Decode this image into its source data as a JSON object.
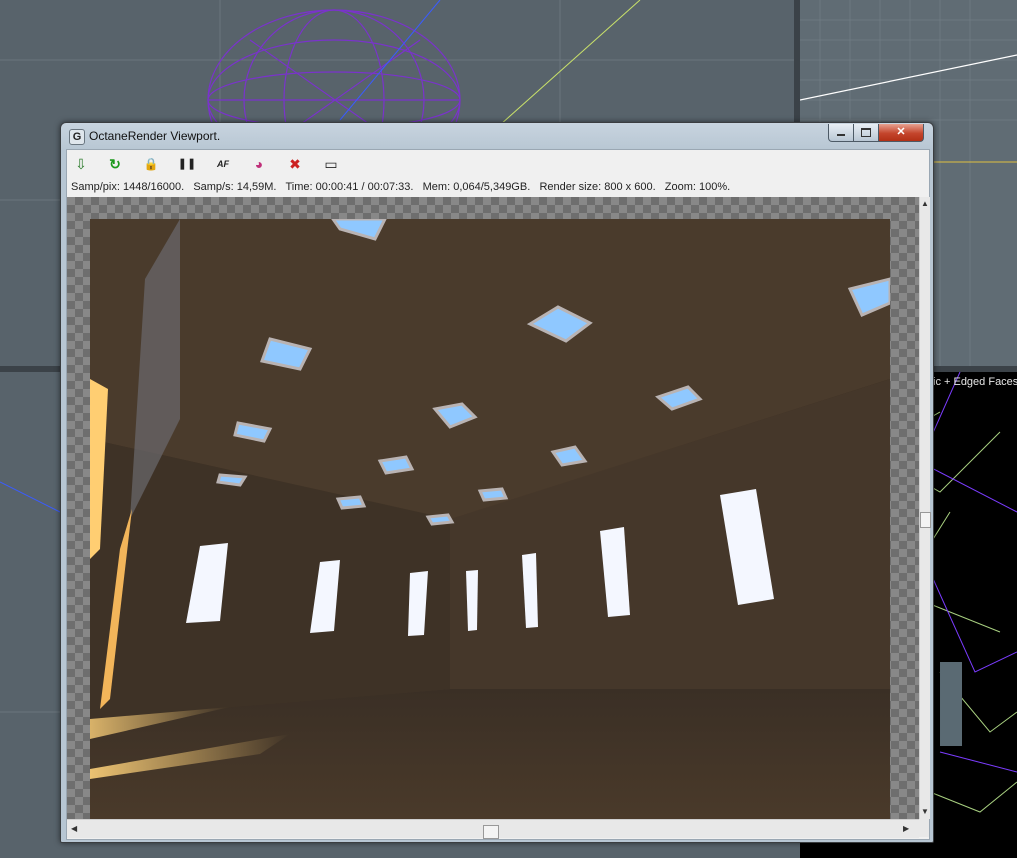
{
  "window": {
    "title": "OctaneRender Viewport.",
    "app_icon": "octane-logo-icon"
  },
  "toolbar": {
    "buttons": [
      {
        "name": "send-scene-icon",
        "glyph": "⇩"
      },
      {
        "name": "restart-render-icon",
        "glyph": "↻"
      },
      {
        "name": "lock-icon",
        "glyph": "🔒"
      },
      {
        "name": "pause-icon",
        "glyph": "❚❚"
      },
      {
        "name": "autofocus-icon",
        "glyph": "AF"
      },
      {
        "name": "color-picker-icon",
        "glyph": "◕"
      },
      {
        "name": "stop-render-icon",
        "glyph": "✖"
      },
      {
        "name": "display-settings-icon",
        "glyph": "▭"
      }
    ]
  },
  "status": {
    "samp_pix": "Samp/pix: 1448/16000.",
    "samp_s": "Samp/s: 14,59M.",
    "time": "Time: 00:00:41 / 00:07:33.",
    "mem": "Mem: 0,064/5,349GB.",
    "render_size": "Render size: 800 x 600.",
    "zoom": "Zoom: 100%."
  },
  "background": {
    "viewport_label": "ic + Edged Faces"
  },
  "colors": {
    "wireframe_sphere": "#7a33cc",
    "viewport_bg": "#58636b",
    "close_button": "#c4452c"
  }
}
